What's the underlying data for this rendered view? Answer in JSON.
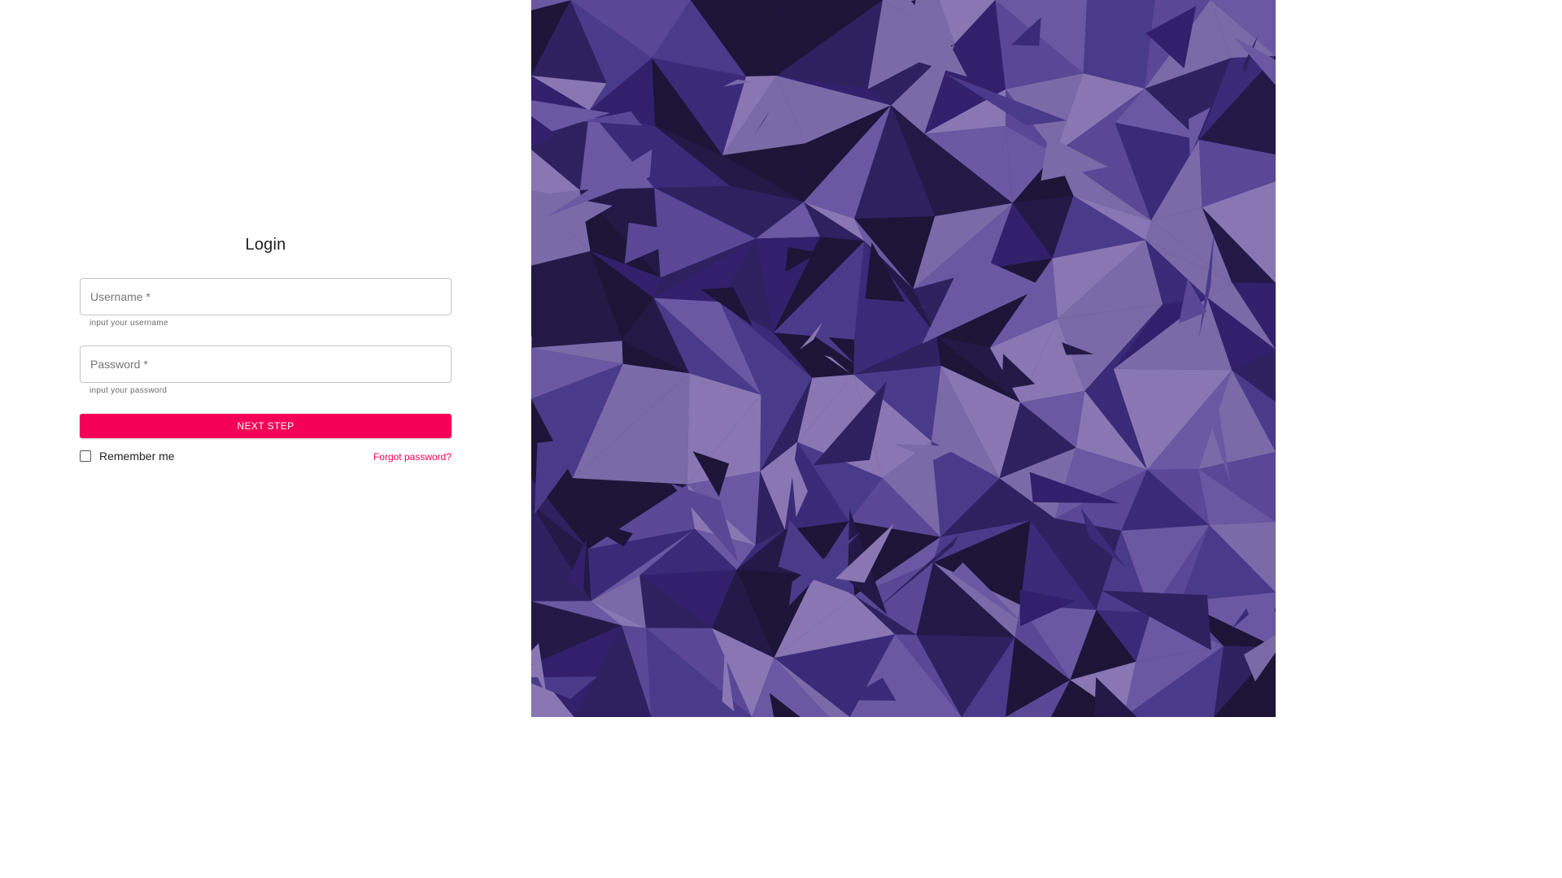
{
  "login": {
    "title": "Login",
    "username": {
      "placeholder": "Username *",
      "helper": "input your username"
    },
    "password": {
      "placeholder": "Password *",
      "helper": "input your password"
    },
    "next_button_label": "NEXT STEP",
    "remember_label": "Remember me",
    "remember_checked": false,
    "forgot_label": "Forgot password?"
  },
  "colors": {
    "accent": "#f50057",
    "art_dark": "#1f1640",
    "art_mid": "#3b2a78",
    "art_light": "#7b6aa8"
  },
  "background_art": "low-poly-purple-lion"
}
